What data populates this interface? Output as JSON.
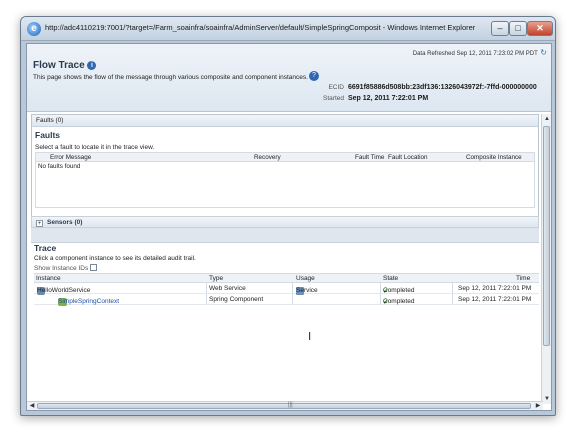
{
  "window": {
    "title": "http://adc4110219:7001/?target=/Farm_soainfra/soainfra/AdminServer/default/SimpleSpringComposit - Windows Internet Explorer",
    "minimize": "–",
    "maximize": "□",
    "close": "✕"
  },
  "header": {
    "refresh_text": "Data Refreshed Sep 12, 2011 7:23:02 PM PDT",
    "title": "Flow Trace",
    "description": "This page shows the flow of the message through various composite and component instances.",
    "ecid_label": "ECID",
    "ecid_value": "6691f85886d508bb:23df136:1326043972f:-7ffd-000000000",
    "started_label": "Started",
    "started_value": "Sep 12, 2011 7:22:01 PM"
  },
  "faults": {
    "section_label": "Faults (0)",
    "title": "Faults",
    "hint": "Select a fault to locate it in the trace view.",
    "columns": [
      "Error Message",
      "Recovery",
      "Fault Time",
      "Fault Location",
      "Composite Instance"
    ],
    "empty_text": "No faults found"
  },
  "sensors": {
    "label": "Sensors (0)"
  },
  "trace": {
    "title": "Trace",
    "hint": "Click a component instance to see its detailed audit trail.",
    "show_ids_label": "Show Instance IDs",
    "columns": [
      "Instance",
      "Type",
      "Usage",
      "State",
      "Time"
    ],
    "rows": [
      {
        "instance": "HelloWorldService",
        "type": "Web Service",
        "usage": "Service",
        "state": "Completed",
        "time": "Sep 12, 2011 7:22:01 PM"
      },
      {
        "instance": "SimpleSpringContext",
        "type": "Spring Component",
        "usage": "",
        "state": "Completed",
        "time": "Sep 12, 2011 7:22:01 PM"
      }
    ]
  }
}
